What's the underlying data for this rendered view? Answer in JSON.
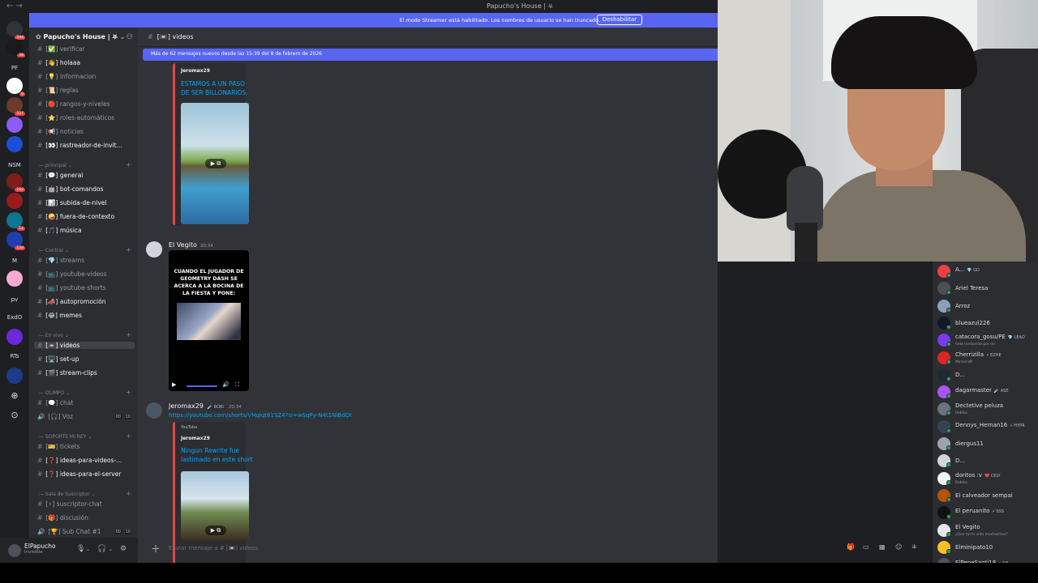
{
  "window": {
    "title": "Papucho's House | ⛧",
    "nav": "← →"
  },
  "banner": {
    "text": "El modo Streamer está habilitado. Los nombres de usuario se han truncado.",
    "button": "Deshabilitar"
  },
  "servers": [
    {
      "label": "",
      "badge": "244",
      "color": "#313338"
    },
    {
      "label": "",
      "badge": "38",
      "color": "#1a1a1a"
    },
    {
      "label": "PF",
      "badge": "",
      "color": ""
    },
    {
      "label": "",
      "badge": "8",
      "color": "#ffffff"
    },
    {
      "label": "",
      "badge": "327",
      "color": "#6b3a2a"
    },
    {
      "label": "",
      "badge": "",
      "color": "#8b5cf6"
    },
    {
      "label": "",
      "badge": "",
      "color": "#1d4ed8"
    },
    {
      "label": "NSM",
      "badge": "",
      "color": ""
    },
    {
      "label": "",
      "badge": "182",
      "color": "#7f1d1d"
    },
    {
      "label": "",
      "badge": "",
      "color": "#991b1b"
    },
    {
      "label": "",
      "badge": "12",
      "color": "#0e7490"
    },
    {
      "label": "",
      "badge": "128",
      "color": "#1e40af"
    },
    {
      "label": "M",
      "badge": "",
      "color": ""
    },
    {
      "label": "",
      "badge": "",
      "color": "#f9a8d4"
    },
    {
      "label": "pv",
      "badge": "",
      "color": ""
    },
    {
      "label": "ExdO",
      "badge": "",
      "color": ""
    },
    {
      "label": "",
      "badge": "",
      "color": "#6d28d9"
    },
    {
      "label": "RTs",
      "badge": "",
      "color": ""
    },
    {
      "label": "",
      "badge": "",
      "color": "#1e3a8a"
    }
  ],
  "sidebar": {
    "server_name": "Papucho's House | ⛧",
    "channels": [
      {
        "name": "[✅] verificar",
        "style": ""
      },
      {
        "name": "[👋] holaaa",
        "style": "bright"
      },
      {
        "name": "[💡] informacion",
        "style": ""
      },
      {
        "name": "[📜] reglas",
        "style": ""
      },
      {
        "name": "[🔴] rangos-y-niveles",
        "style": ""
      },
      {
        "name": "[⭐] roles-automáticos",
        "style": ""
      },
      {
        "name": "[📢] noticias",
        "style": ""
      },
      {
        "name": "[👀] rastreador-de-invit...",
        "style": "bright"
      },
      {
        "name": "[💬] general",
        "style": "bright"
      },
      {
        "name": "[🤖] bot-comandos",
        "style": "bright"
      },
      {
        "name": "[📊] subida-de-nivel",
        "style": "bright"
      },
      {
        "name": "[🤪] fuera-de-contexto",
        "style": "bright"
      },
      {
        "name": "[🎵] música",
        "style": "bright"
      },
      {
        "name": "[💎] streams",
        "style": ""
      },
      {
        "name": "[📺] youtube-videos",
        "style": ""
      },
      {
        "name": "[📺] youtube-shorts",
        "style": ""
      },
      {
        "name": "[📣] autopromoción",
        "style": "bright"
      },
      {
        "name": "[😂] memes",
        "style": "bright"
      },
      {
        "name": "[📼] videos",
        "style": "sel"
      },
      {
        "name": "[🖥️] set-up",
        "style": "bright"
      },
      {
        "name": "[🎬] stream-clips",
        "style": "bright"
      },
      {
        "name": "[🗨️] chat",
        "style": ""
      },
      {
        "name": "[🎧] Voz",
        "style": ""
      },
      {
        "name": "[🎫] tickets",
        "style": ""
      },
      {
        "name": "[❓] ideas-para-videos-...",
        "style": "bright"
      },
      {
        "name": "[❓] ideas-para-el-server",
        "style": "bright"
      },
      {
        "name": "[⚡] suscriptor-chat",
        "style": ""
      },
      {
        "name": "[🎁] discusión",
        "style": ""
      },
      {
        "name": "[🏆] Sub Chat #1",
        "style": ""
      }
    ],
    "categories": [
      "principal",
      "Central",
      "En vivo",
      "OLIMPO",
      "SOPORTE MI REY",
      "Sala de Suscriptor"
    ],
    "voice_tags": [
      "00",
      "10"
    ]
  },
  "user": {
    "name": "ElPapucho",
    "status": "Invisible"
  },
  "main": {
    "header": "[📼] videos",
    "new_messages": "Más de 62 mensajes nuevos desde las 15:39 del 8 de febrero de 2026",
    "embed1": {
      "author": "Jeromax29",
      "title": "ESTAMOS A UN PASO DE SER BILLONARIOS."
    },
    "msg2": {
      "author": "El Vegito",
      "time": "20:34",
      "caption": "CUANDO EL JUGADOR DE GEOMETRY DASH SE ACERCA A LA BOCINA DE LA FIESTA Y PONE:"
    },
    "msg3": {
      "author": "Jeromax29",
      "role": "☄️ BOBI",
      "time": "20:34",
      "link": "https://youtube.com/shorts/VHqiqt61SZ4?si=wSqPy-N4t1NiBdOt",
      "provider": "YouTube",
      "embed_author": "Jeromax29",
      "embed_title": "Ningun Rewrite fue lastimado en este short"
    },
    "composer_placeholder": "Enviar mensaje a # [📼] videos"
  },
  "members": [
    {
      "name": "A...",
      "badge": "💎 GD",
      "status": "",
      "color": "#f23f43"
    },
    {
      "name": "Ariel Teresa",
      "badge": "",
      "status": "",
      "color": "#4e5058"
    },
    {
      "name": "Arroz",
      "badge": "",
      "status": "",
      "color": "#8aa0b8"
    },
    {
      "name": "blueazul226",
      "badge": "",
      "status": "",
      "color": "#111827"
    },
    {
      "name": "catacora_gosu/PE",
      "badge": "💎 LEAD",
      "status": "hola (seducida por mi",
      "color": "#7c3aed"
    },
    {
      "name": "Cherrizilla",
      "badge": "⚡ EZHE",
      "status": "Minecraft",
      "color": "#dc2626"
    },
    {
      "name": "D...",
      "badge": "",
      "status": "",
      "color": "#1f2937"
    },
    {
      "name": "dagarmaster",
      "badge": "☄️ ASE",
      "status": "",
      "color": "#a855f7"
    },
    {
      "name": "Dectetive peluza",
      "badge": "",
      "status": "Roblox",
      "color": "#6b7280"
    },
    {
      "name": "Dennys_Hernan16",
      "badge": "⚡ HYPR",
      "status": "",
      "color": "#374151"
    },
    {
      "name": "diergus11",
      "badge": "",
      "status": "",
      "color": "#9ca3af"
    },
    {
      "name": "D...",
      "badge": "",
      "status": "",
      "color": "#d1d5db"
    },
    {
      "name": "doritos :v",
      "badge": "❤️ CELY",
      "status": "Roblox",
      "color": "#f3f4f6"
    },
    {
      "name": "El calveador sempai",
      "badge": "",
      "status": "",
      "color": "#b45309"
    },
    {
      "name": "El peruanito",
      "badge": "⚡ SSS",
      "status": "",
      "color": "#111111"
    },
    {
      "name": "El Vegito",
      "badge": "",
      "status": "¿Que tal la vida muchachos?",
      "color": "#e5e7eb"
    },
    {
      "name": "Elminipato10",
      "badge": "",
      "status": "",
      "color": "#fbbf24"
    },
    {
      "name": "ElPepeSanti18",
      "badge": "⚡ SH",
      "status": "",
      "color": "#4b5563"
    }
  ]
}
